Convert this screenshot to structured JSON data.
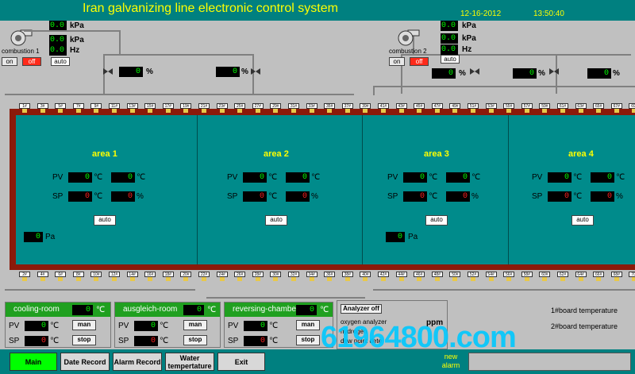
{
  "header": {
    "title": "Iran galvanizing line electronic control system",
    "date": "12-16-2012",
    "time": "13:50:40"
  },
  "combustion": [
    {
      "name": "combustion 1",
      "readings": [
        {
          "value": "0.0",
          "unit": "kPa"
        },
        {
          "value": "0.0",
          "unit": "kPa"
        },
        {
          "value": "0.0",
          "unit": "Hz"
        }
      ],
      "buttons": {
        "on": "on",
        "off": "off",
        "auto": "auto"
      },
      "valves": [
        {
          "value": "0",
          "unit": "%"
        },
        {
          "value": "0",
          "unit": "%"
        }
      ]
    },
    {
      "name": "combustion 2",
      "readings": [
        {
          "value": "0.0",
          "unit": "kPa"
        },
        {
          "value": "0.0",
          "unit": "kPa"
        },
        {
          "value": "0.0",
          "unit": "Hz"
        }
      ],
      "buttons": {
        "on": "on",
        "off": "off",
        "auto": "auto"
      },
      "valves": [
        {
          "value": "0",
          "unit": "%"
        },
        {
          "value": "0",
          "unit": "%"
        },
        {
          "value": "0",
          "unit": "%"
        }
      ]
    }
  ],
  "areas": [
    {
      "title": "area 1",
      "pv_label": "PV",
      "sp_label": "SP",
      "pv1": "0",
      "pv2": "0",
      "sp1": "0",
      "sp2": "0",
      "unit_c": "℃",
      "unit_p": "%",
      "auto": "auto",
      "pressure": "0",
      "pressure_unit": "Pa"
    },
    {
      "title": "area 2",
      "pv_label": "PV",
      "sp_label": "SP",
      "pv1": "0",
      "pv2": "0",
      "sp1": "0",
      "sp2": "0",
      "unit_c": "℃",
      "unit_p": "%",
      "auto": "auto"
    },
    {
      "title": "area 3",
      "pv_label": "PV",
      "sp_label": "SP",
      "pv1": "0",
      "pv2": "0",
      "sp1": "0",
      "sp2": "0",
      "unit_c": "℃",
      "unit_p": "%",
      "auto": "auto",
      "pressure": "0",
      "pressure_unit": "Pa"
    },
    {
      "title": "area 4",
      "pv_label": "PV",
      "sp_label": "SP",
      "pv1": "0",
      "pv2": "0",
      "sp1": "0",
      "sp2": "0",
      "unit_c": "℃",
      "unit_p": "%",
      "auto": "auto"
    }
  ],
  "burners_top": [
    "1#",
    "3#",
    "5#",
    "7#",
    "9#",
    "11#",
    "13#",
    "15#",
    "17#",
    "19#",
    "21#",
    "23#",
    "25#",
    "27#",
    "29#",
    "31#",
    "33#",
    "35#",
    "37#",
    "39#",
    "41#",
    "43#",
    "45#",
    "47#",
    "49#",
    "51#",
    "53#",
    "55#",
    "57#",
    "59#",
    "61#",
    "63#",
    "65#",
    "67#",
    "69#"
  ],
  "burners_bottom": [
    "2#",
    "4#",
    "6#",
    "8#",
    "10#",
    "12#",
    "14#",
    "16#",
    "18#",
    "20#",
    "22#",
    "24#",
    "26#",
    "28#",
    "30#",
    "32#",
    "34#",
    "36#",
    "38#",
    "40#",
    "42#",
    "44#",
    "46#",
    "48#",
    "50#",
    "52#",
    "54#",
    "56#",
    "58#",
    "60#",
    "62#",
    "64#",
    "66#",
    "68#",
    "70#"
  ],
  "zones": [
    {
      "name": "cooling-room",
      "value": "0",
      "unit": "℃",
      "pv_label": "PV",
      "sp_label": "SP",
      "pv": "0",
      "sp": "0",
      "btn1": "man",
      "btn2": "stop"
    },
    {
      "name": "ausgleich-room",
      "value": "0",
      "unit": "℃",
      "pv_label": "PV",
      "sp_label": "SP",
      "pv": "0",
      "sp": "0",
      "btn1": "man",
      "btn2": "stop"
    },
    {
      "name": "reversing-chamber",
      "value": "0",
      "unit": "℃",
      "pv_label": "PV",
      "sp_label": "SP",
      "pv": "0",
      "sp": "0",
      "btn1": "man",
      "btn2": "stop"
    }
  ],
  "analyzer": {
    "button": "Analyzer off",
    "rows": [
      "oxygen analyzer",
      "hydrogen",
      "dew point dete"
    ],
    "unit": "ppm"
  },
  "boards": {
    "board1": "1#board temperature",
    "board2": "2#board temperature"
  },
  "nav": {
    "main": "Main",
    "date_record": "Date Record",
    "alarm_record": "Alarm Record",
    "water_temp": "Water tempertature",
    "exit": "Exit",
    "new_alarm": "new alarm"
  },
  "watermark": "61964800.com",
  "colors": {
    "header": "#008080",
    "chamber": "#008b8b",
    "furnace_wall": "#8b1a0a",
    "zone_header": "#20a020",
    "active_nav": "#00ff00"
  }
}
